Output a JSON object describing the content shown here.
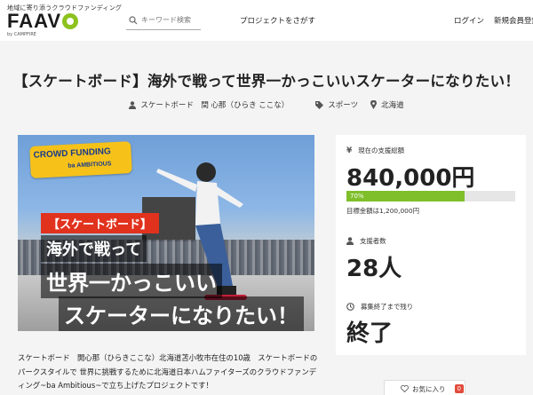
{
  "header": {
    "tagline": "地域に寄り添うクラウドファンディング",
    "logo_text": "FAAV",
    "logo_sub": "by CAMPFIRE",
    "search_placeholder": "キーワード検索",
    "nav_find": "プロジェクトをさがす",
    "nav_login": "ログイン",
    "nav_register": "新規会員登録"
  },
  "project": {
    "title": "【スケートボード】海外で戦って世界一かっこいいスケーターになりたい！",
    "owner": "スケートボード　間 心那（ひらき ここな）",
    "category": "スポーツ",
    "location": "北海道",
    "description": "スケートボード　開心那（ひらきここな）北海道苫小牧市在住の10歳　スケートボードのパークスタイルで 世界に挑戦するために北海道日本ハムファイターズのクラウドファンディング~ba Ambitious~で立ち上げたプロジェクトです！"
  },
  "hero": {
    "logo_text": "CROWD FUNDING",
    "logo_sub": "ba AMBITIOUS",
    "tag": "【スケートボード】",
    "line1": "海外で戦って",
    "line2": "世界一かっこいい",
    "line3": "スケーターになりたい！"
  },
  "stats": {
    "raised_label": "現在の支援総額",
    "raised": "840,000円",
    "progress_text": "70%",
    "progress_percent": 70,
    "goal": "目標金額は1,200,000円",
    "backers_label": "支援者数",
    "backers": "28人",
    "remaining_label": "募集終了まで残り",
    "remaining": "終了"
  },
  "favorite": {
    "label": "お気に入り",
    "count": "0"
  },
  "colors": {
    "accent_green": "#7fbf2a",
    "logo_green": "#8dc21f",
    "tag_red": "#e1321e",
    "badge_red": "#e14b3b"
  }
}
